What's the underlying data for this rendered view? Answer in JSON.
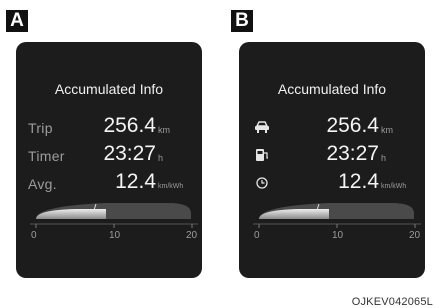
{
  "panels": [
    {
      "tag": "A",
      "title": "Accumulated Info",
      "rows": [
        {
          "label": "Trip",
          "icon": "",
          "value": "256.4",
          "unit": "km"
        },
        {
          "label": "Timer",
          "icon": "",
          "value": "23:27",
          "unit": "h"
        },
        {
          "label": "Avg.",
          "icon": "",
          "value": "12.4",
          "unit": "km/kWh"
        }
      ],
      "gauge": {
        "min_label": "0",
        "mid_label": "10",
        "max_label": "20",
        "level": 0.5
      }
    },
    {
      "tag": "B",
      "title": "Accumulated Info",
      "rows": [
        {
          "label": "",
          "icon": "car-icon",
          "value": "256.4",
          "unit": "km"
        },
        {
          "label": "",
          "icon": "charging-station-icon",
          "value": "23:27",
          "unit": "h"
        },
        {
          "label": "",
          "icon": "clock-icon",
          "value": "12.4",
          "unit": "km/kWh"
        }
      ],
      "gauge": {
        "min_label": "0",
        "mid_label": "10",
        "max_label": "20",
        "level": 0.5
      }
    }
  ],
  "caption": "OJKEV042065L",
  "colors": {
    "screen_bg": "#1c1c1c",
    "text": "#f4f4f4",
    "dim_text": "#9c9c9c"
  }
}
